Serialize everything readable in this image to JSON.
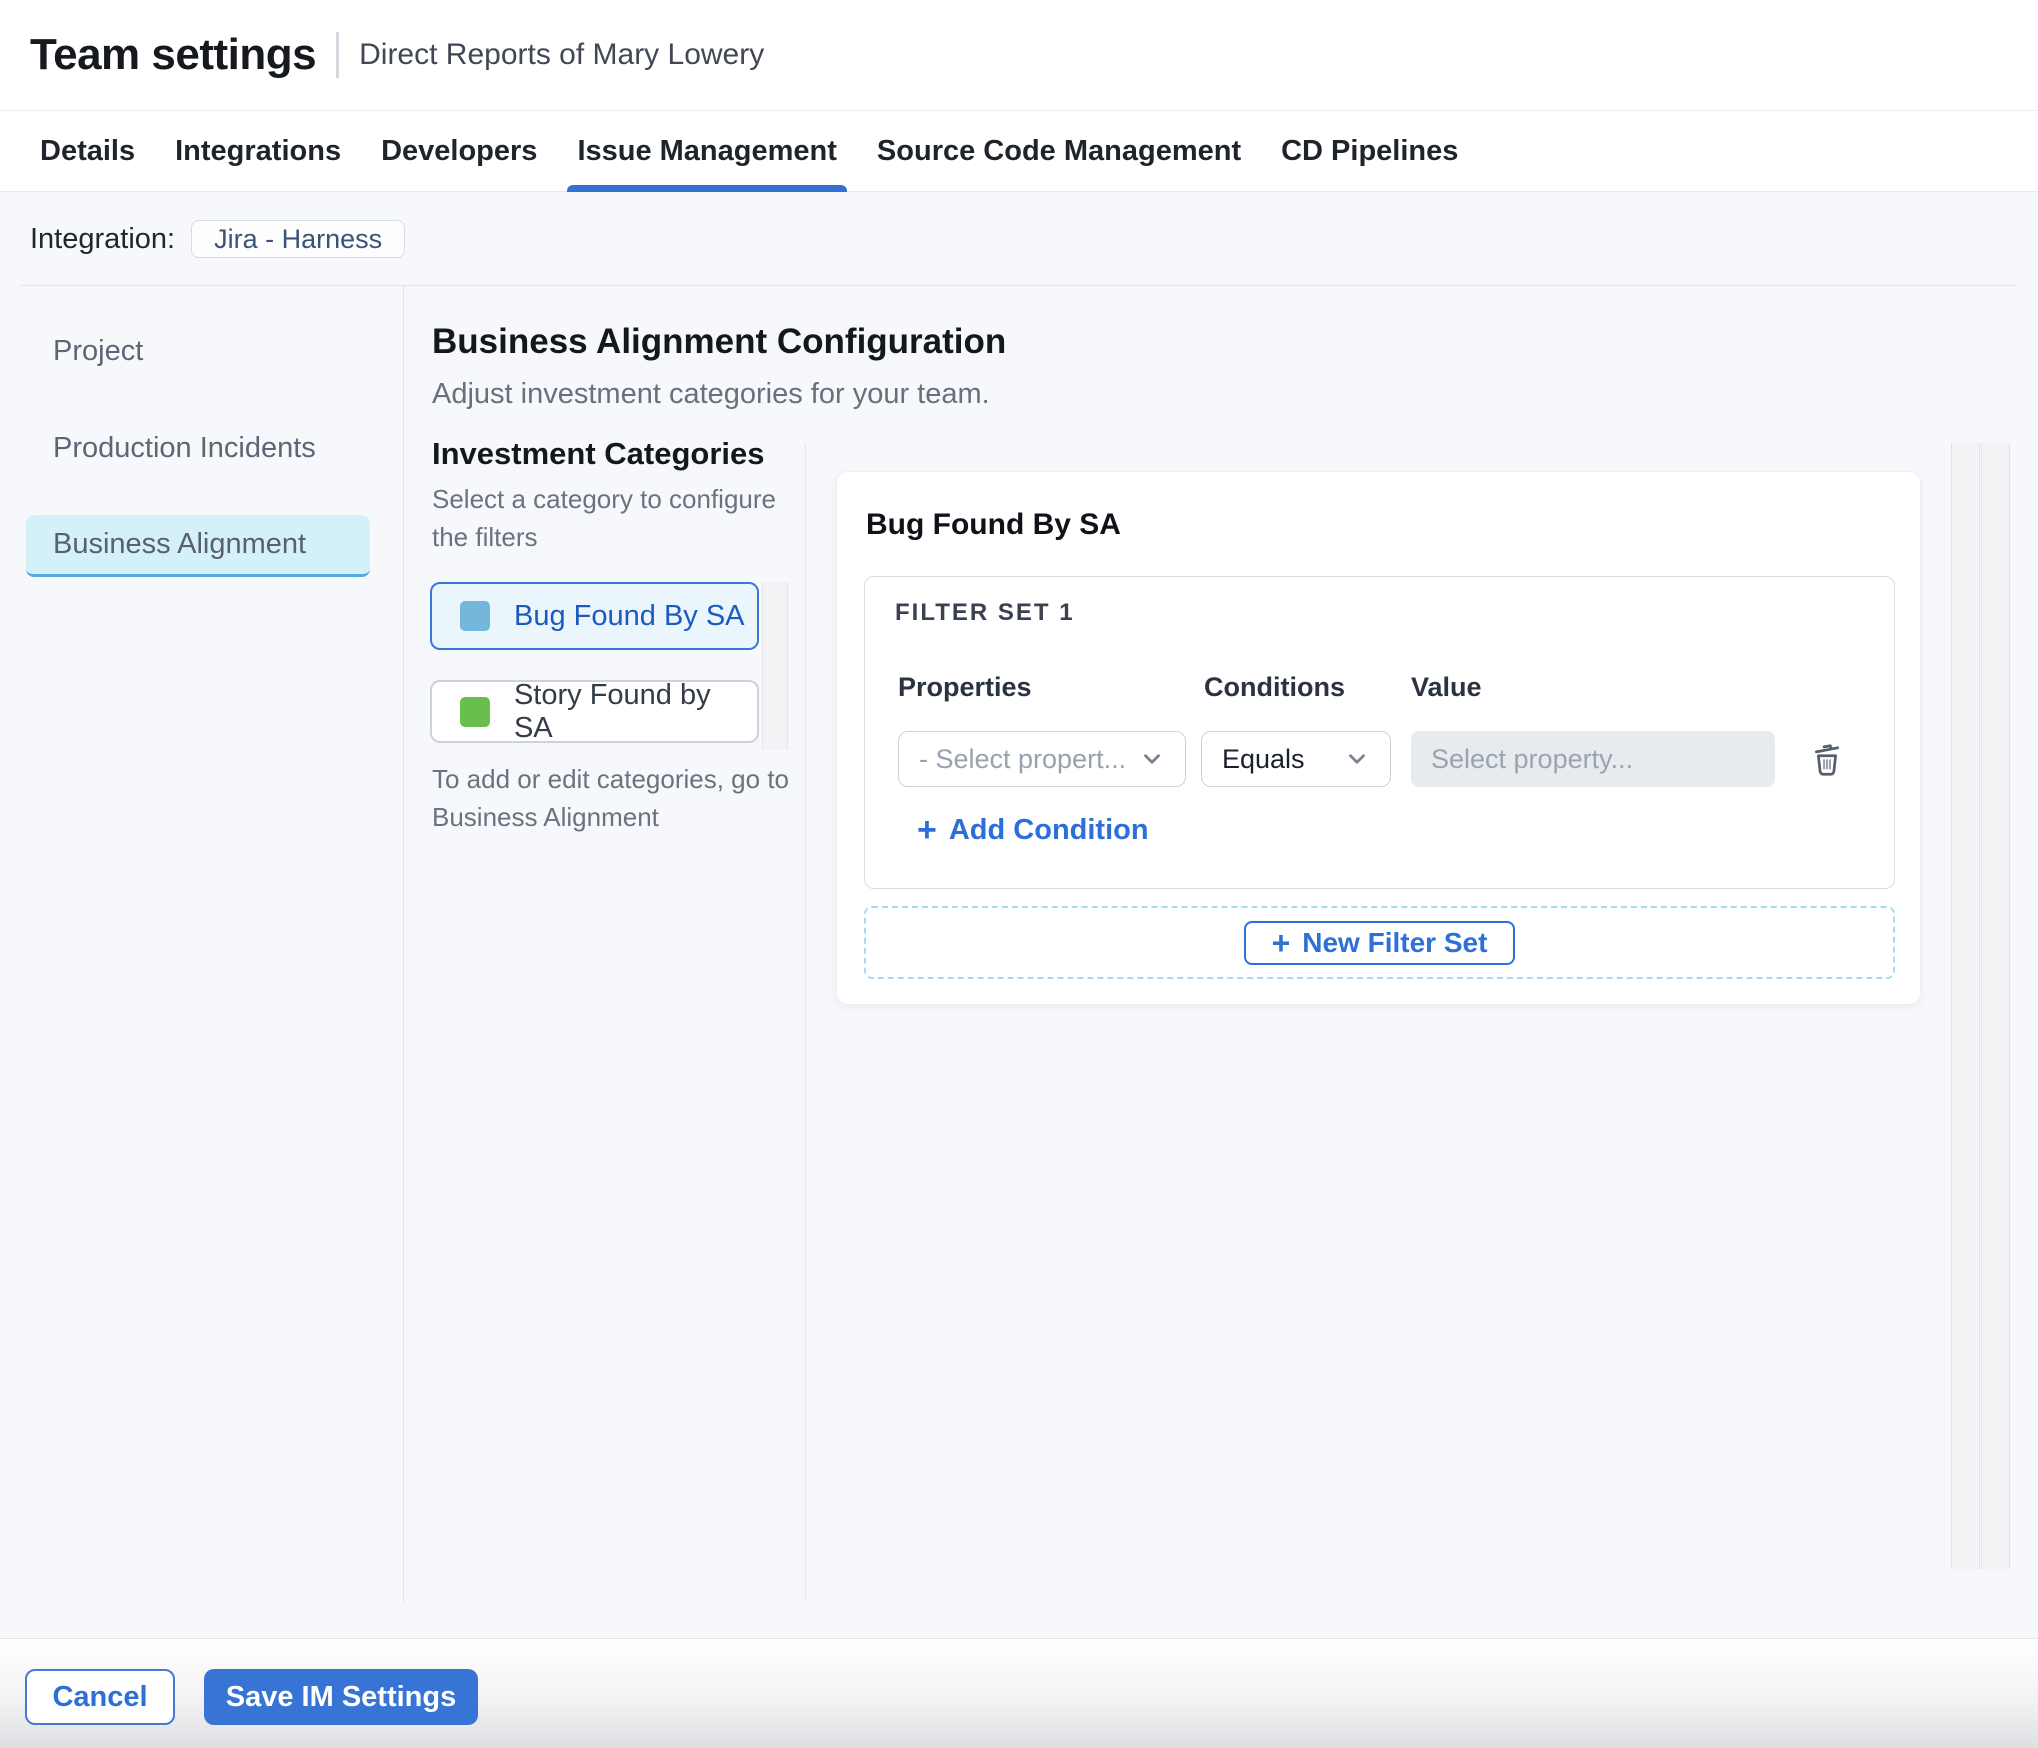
{
  "header": {
    "title": "Team settings",
    "subtitle": "Direct Reports of Mary Lowery"
  },
  "tabs": [
    {
      "label": "Details",
      "active": false
    },
    {
      "label": "Integrations",
      "active": false
    },
    {
      "label": "Developers",
      "active": false
    },
    {
      "label": "Issue Management",
      "active": true
    },
    {
      "label": "Source Code Management",
      "active": false
    },
    {
      "label": "CD Pipelines",
      "active": false
    }
  ],
  "integration": {
    "label": "Integration:",
    "chip": "Jira - Harness"
  },
  "sidebar": {
    "items": [
      {
        "label": "Project",
        "selected": false
      },
      {
        "label": "Production Incidents",
        "selected": false
      },
      {
        "label": "Business Alignment",
        "selected": true
      }
    ]
  },
  "main": {
    "heading": "Business Alignment Configuration",
    "subheading": "Adjust investment categories for your team.",
    "categories": {
      "title": "Investment Categories",
      "description": "Select a category to configure the filters",
      "items": [
        {
          "label": "Bug Found By SA",
          "swatch_color": "#73b8dc",
          "selected": true
        },
        {
          "label": "Story Found by SA",
          "swatch_color": "#68bf4e",
          "selected": false
        }
      ],
      "note": "To add or edit categories, go to Business Alignment"
    },
    "panel": {
      "title": "Bug Found By SA",
      "filter_set": {
        "title": "FILTER SET 1",
        "columns": {
          "properties": "Properties",
          "conditions": "Conditions",
          "value": "Value"
        },
        "row": {
          "property_placeholder": "- Select propert...",
          "condition_selected": "Equals",
          "value_placeholder": "Select property..."
        },
        "add_condition": {
          "plus": "+",
          "label": "Add Condition"
        }
      },
      "new_filter_set": {
        "plus": "+",
        "label": "New Filter Set"
      }
    }
  },
  "footer": {
    "cancel_label": "Cancel",
    "save_label": "Save IM Settings"
  },
  "colors": {
    "accent_blue": "#3570d3",
    "link_blue": "#2c6fd8",
    "selected_sidebar_bg": "#d4f1fa",
    "selected_category_bg": "#eaf6fc",
    "selected_category_border": "#3a78d7",
    "bug_swatch": "#73b8dc",
    "story_swatch": "#68bf4e",
    "content_bg": "#f7f8fb",
    "dashed_border": "#a7dbee",
    "value_field_bg": "#e8ebee"
  }
}
